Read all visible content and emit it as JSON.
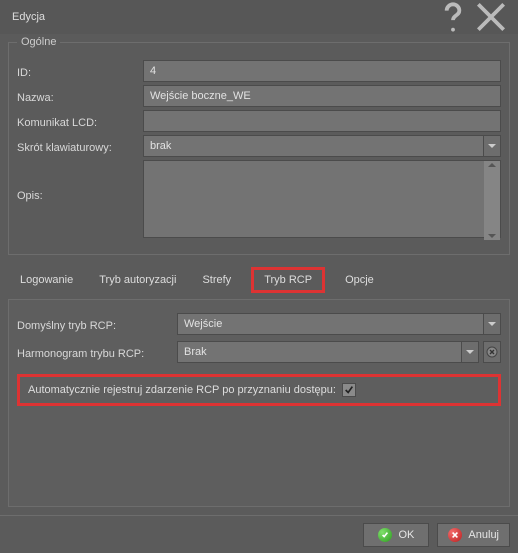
{
  "titlebar": {
    "title": "Edycja"
  },
  "general": {
    "legend": "Ogólne",
    "id_label": "ID:",
    "id_value": "4",
    "name_label": "Nazwa:",
    "name_value": "Wejście boczne_WE",
    "lcd_label": "Komunikat LCD:",
    "lcd_value": "",
    "shortcut_label": "Skrót klawiaturowy:",
    "shortcut_value": "brak",
    "desc_label": "Opis:",
    "desc_value": ""
  },
  "tabs": {
    "t1": "Logowanie",
    "t2": "Tryb autoryzacji",
    "t3": "Strefy",
    "t4": "Tryb RCP",
    "t5": "Opcje",
    "active": "t4"
  },
  "rcp": {
    "default_label": "Domyślny tryb RCP:",
    "default_value": "Wejście",
    "sched_label": "Harmonogram trybu RCP:",
    "sched_value": "Brak",
    "auto_label": "Automatycznie rejestruj zdarzenie RCP po przyznaniu dostępu:",
    "auto_checked": true
  },
  "footer": {
    "ok": "OK",
    "cancel": "Anuluj"
  }
}
